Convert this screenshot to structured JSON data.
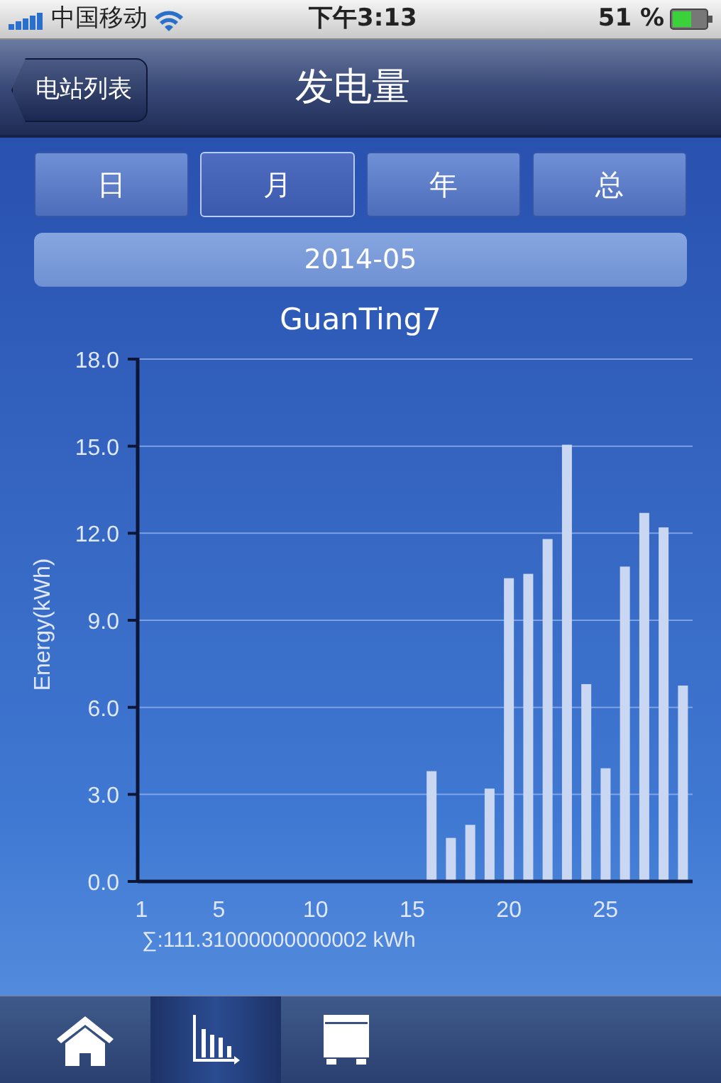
{
  "status_bar": {
    "carrier": "中国移动",
    "time": "下午3:13",
    "battery": "51 %"
  },
  "nav_bar": {
    "back": "电站列表",
    "title": "发电量"
  },
  "segments": [
    {
      "label": "日",
      "selected": false
    },
    {
      "label": "月",
      "selected": true
    },
    {
      "label": "年",
      "selected": false
    },
    {
      "label": "总",
      "selected": false
    }
  ],
  "date": "2014-05",
  "chart": {
    "total": "∑:111.31000000000002 kWh",
    "chart_data": {
      "type": "bar",
      "title": "GuanTing7",
      "ylabel": "Energy(kWh)",
      "grid": true,
      "x": [
        16,
        17,
        18,
        19,
        20,
        21,
        22,
        23,
        24,
        25,
        26,
        27,
        28,
        29
      ],
      "xlim": [
        0.8,
        29.5
      ],
      "values": [
        3.8,
        1.5,
        1.95,
        3.2,
        10.45,
        10.6,
        11.8,
        15.05,
        6.8,
        3.9,
        10.85,
        12.7,
        12.2,
        6.75
      ],
      "ylim": [
        0,
        18
      ],
      "yticks": [
        {
          "value": 0,
          "label": "0.0"
        },
        {
          "value": 3,
          "label": "3.0"
        },
        {
          "value": 6,
          "label": "6.0"
        },
        {
          "value": 9,
          "label": "9.0"
        },
        {
          "value": 12,
          "label": "12.0"
        },
        {
          "value": 15,
          "label": "15.0"
        },
        {
          "value": 18,
          "label": "18.0"
        }
      ],
      "xticks": [
        1,
        5,
        10,
        15,
        20,
        25
      ]
    }
  },
  "tab_bar": [
    {
      "kind": "home",
      "selected": false
    },
    {
      "kind": "chart",
      "selected": true
    },
    {
      "kind": "device",
      "selected": false
    }
  ]
}
